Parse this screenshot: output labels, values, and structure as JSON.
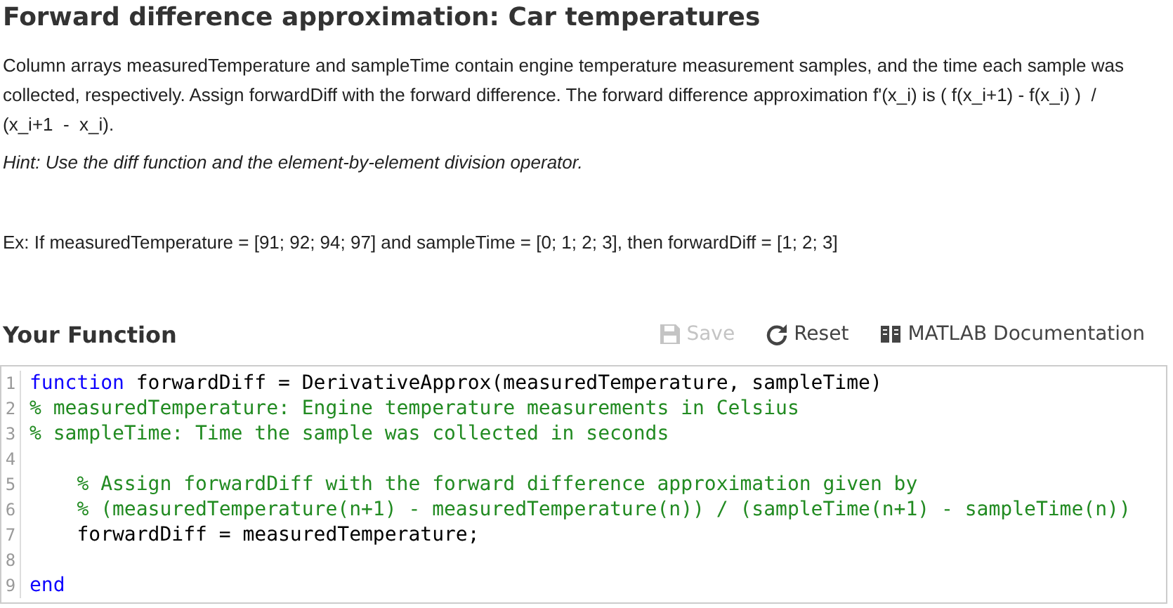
{
  "title": "Forward difference approximation: Car temperatures",
  "description": "Column arrays measuredTemperature and sampleTime contain engine temperature measurement samples, and the time each sample was collected, respectively. Assign forwardDiff with the forward difference. The forward difference approximation f'(x_i) is ( f(x_i+1) - f(x_i) )  /  (x_i+1  -  x_i).",
  "hint": "Hint: Use the diff function and the element-by-element division operator.",
  "example": "Ex: If measuredTemperature = [91; 92; 94; 97] and sampleTime = [0; 1; 2; 3], then forwardDiff = [1; 2; 3]",
  "section_title": "Your Function",
  "toolbar": [
    {
      "kind": "save",
      "label": "Save",
      "disabled": true
    },
    {
      "kind": "reset",
      "label": "Reset",
      "disabled": false
    },
    {
      "kind": "docs",
      "label": "MATLAB Documentation",
      "disabled": false
    }
  ],
  "code_lines": [
    {
      "number": "1",
      "segments": [
        {
          "kind": "keyword",
          "text": "function"
        },
        {
          "kind": "plain",
          "text": " forwardDiff = DerivativeApprox(measuredTemperature, sampleTime)"
        }
      ]
    },
    {
      "number": "2",
      "segments": [
        {
          "kind": "comment",
          "text": "% measuredTemperature: Engine temperature measurements in Celsius"
        }
      ]
    },
    {
      "number": "3",
      "segments": [
        {
          "kind": "comment",
          "text": "% sampleTime: Time the sample was collected in seconds"
        }
      ]
    },
    {
      "number": "4"
    },
    {
      "number": "5",
      "segments": [
        {
          "kind": "comment",
          "text": "    % Assign forwardDiff with the forward difference approximation given by"
        }
      ]
    },
    {
      "number": "6",
      "segments": [
        {
          "kind": "comment",
          "text": "    % (measuredTemperature(n+1) - measuredTemperature(n)) / (sampleTime(n+1) - sampleTime(n))"
        }
      ]
    },
    {
      "number": "7",
      "segments": [
        {
          "kind": "plain",
          "text": "    forwardDiff = measuredTemperature;"
        }
      ]
    },
    {
      "number": "8"
    },
    {
      "number": "9",
      "segments": [
        {
          "kind": "keyword",
          "text": "end"
        }
      ]
    }
  ]
}
